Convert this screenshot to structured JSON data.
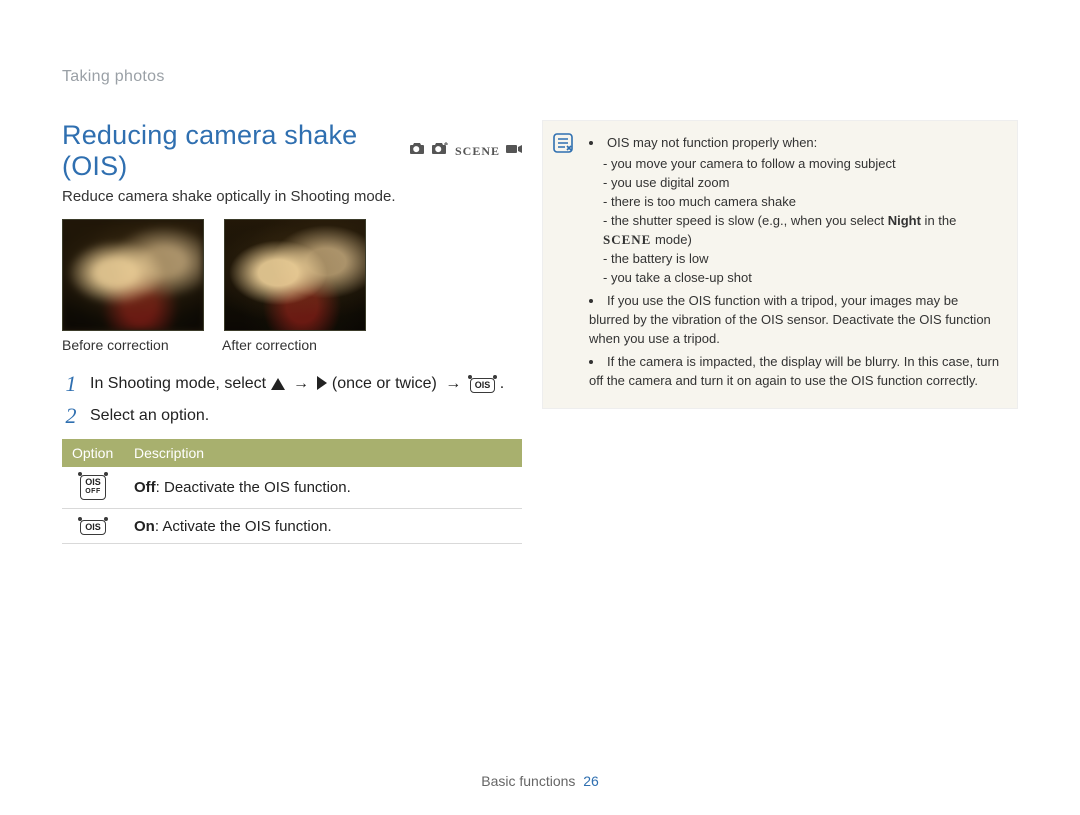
{
  "breadcrumb": "Taking photos",
  "heading": "Reducing camera shake (OIS)",
  "mode_icons": {
    "scene_label": "SCENE"
  },
  "subtitle": "Reduce camera shake optically in Shooting mode.",
  "photos": {
    "before_caption": "Before correction",
    "after_caption": "After correction"
  },
  "steps": {
    "n1": "1",
    "s1_a": "In Shooting mode, select ",
    "s1_b": " (once or twice) ",
    "s1_end": ".",
    "arrow": "→",
    "n2": "2",
    "s2": "Select an option."
  },
  "table": {
    "col_option": "Option",
    "col_desc": "Description",
    "off_chip": "OIS",
    "off_chip_sub": "OFF",
    "on_chip": "OIS",
    "off_label": "Off",
    "off_text": ": Deactivate the OIS function.",
    "on_label": "On",
    "on_text": ": Activate the OIS function."
  },
  "note": {
    "l0": "OIS may not function properly when:",
    "i1": "you move your camera to follow a moving subject",
    "i2": "you use digital zoom",
    "i3": "there is too much camera shake",
    "i4a": "the shutter speed is slow (e.g., when you select ",
    "i4b": "Night",
    "i4c": " in the ",
    "i4d": "SCENE",
    "i4e": " mode)",
    "i5": "the battery is low",
    "i6": "you take a close-up shot",
    "l1": "If you use the OIS function with a tripod, your images may be blurred by the vibration of the OIS sensor. Deactivate the OIS function when you use a tripod.",
    "l2": "If the camera is impacted, the display will be blurry. In this case, turn off the camera and turn it on again to use the OIS function correctly."
  },
  "footer": {
    "section": "Basic functions",
    "page": "26"
  }
}
